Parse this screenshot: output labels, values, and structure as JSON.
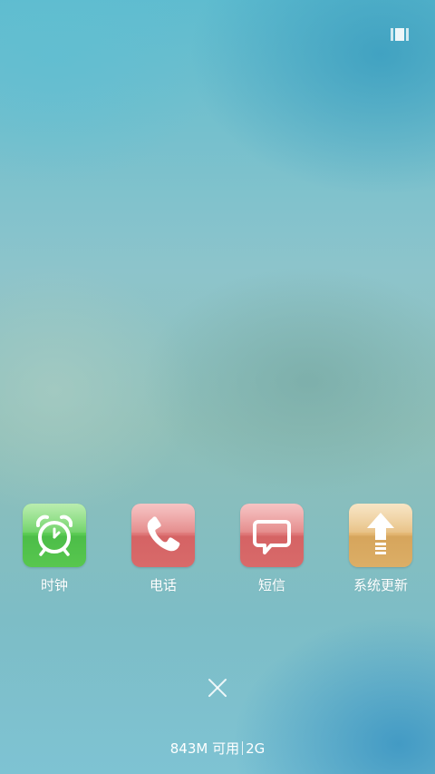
{
  "menu": {
    "icon": "recent-apps-menu-icon"
  },
  "recent_apps": [
    {
      "label": "时钟",
      "icon": "alarm-clock-icon",
      "color": "#5ccc55"
    },
    {
      "label": "电话",
      "icon": "phone-icon",
      "color": "#d86a6a"
    },
    {
      "label": "短信",
      "icon": "message-icon",
      "color": "#d86a6a"
    },
    {
      "label": "系统更新",
      "icon": "upload-arrow-icon",
      "color": "#d6a55c"
    }
  ],
  "clear_all": {
    "icon": "close-icon"
  },
  "memory": {
    "available": "843M 可用",
    "total": "2G"
  }
}
